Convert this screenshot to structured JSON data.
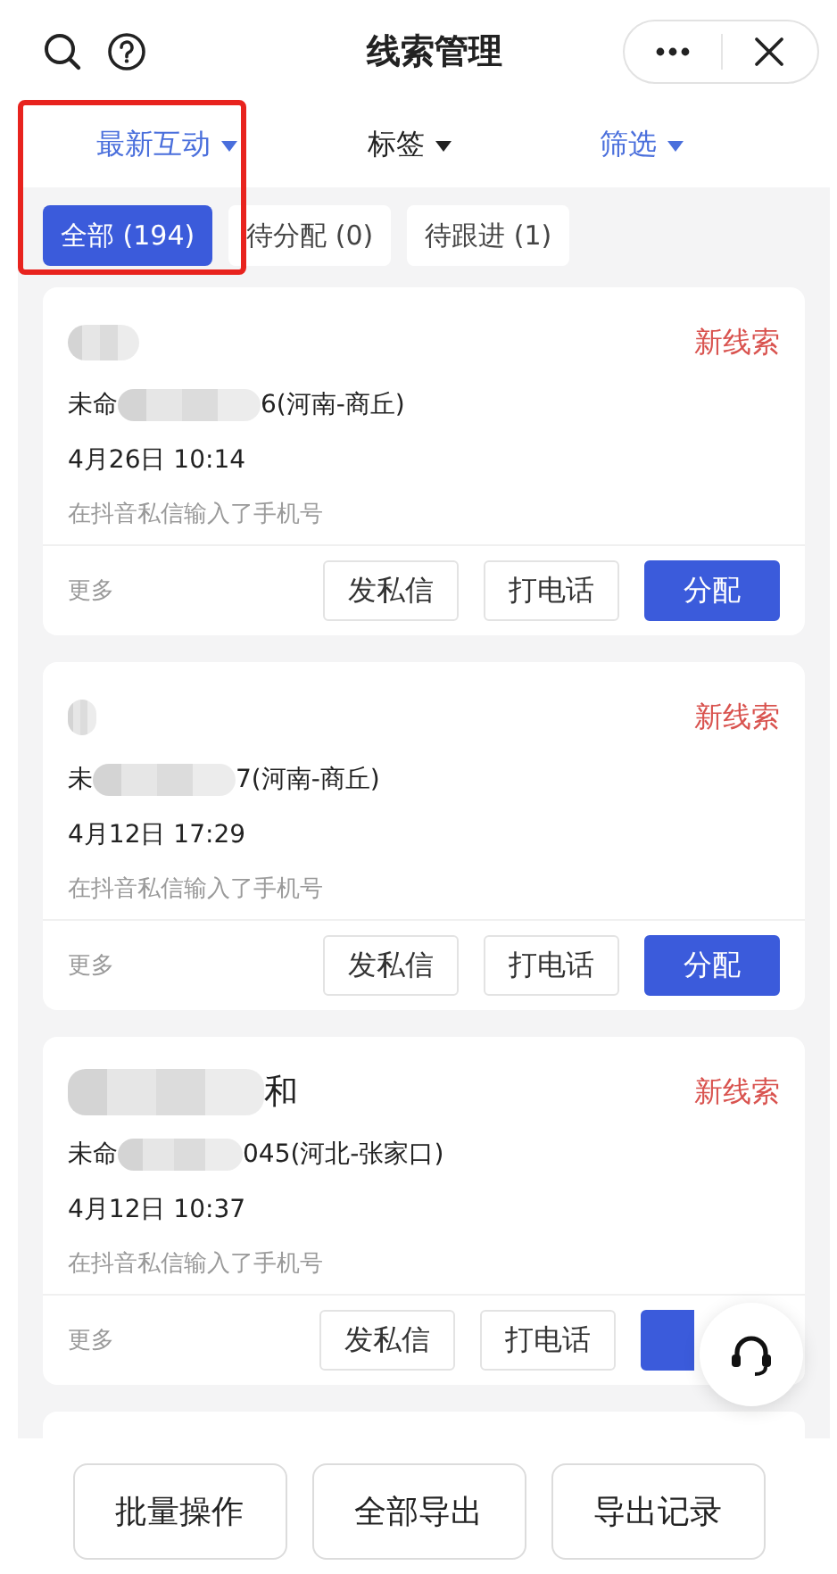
{
  "header": {
    "title": "线索管理"
  },
  "filters": [
    {
      "label": "最新互动",
      "active": true
    },
    {
      "label": "标签",
      "active": false
    },
    {
      "label": "筛选",
      "active": true
    }
  ],
  "highlight_frame": true,
  "chips": [
    {
      "label": "全部 (194)",
      "selected": true
    },
    {
      "label": "待分配 (0)",
      "selected": false
    },
    {
      "label": "待跟进 (1)",
      "selected": false
    }
  ],
  "leads": [
    {
      "phone_prefix": "未命",
      "phone_suffix": "6(河南-商丘)",
      "time": "4月26日 10:14",
      "source": "在抖音私信输入了手机号",
      "status": "新线索",
      "more": "更多",
      "actions": [
        "发私信",
        "打电话",
        "分配"
      ]
    },
    {
      "phone_prefix": "未",
      "phone_suffix": "7(河南-商丘)",
      "time": "4月12日 17:29",
      "source": "在抖音私信输入了手机号",
      "status": "新线索",
      "more": "更多",
      "actions": [
        "发私信",
        "打电话",
        "分配"
      ]
    },
    {
      "name": "和",
      "phone_prefix": "未命",
      "phone_suffix": "045(河北-张家口)",
      "time": "4月12日 10:37",
      "source": "在抖音私信输入了手机号",
      "status": "新线索",
      "more": "更多",
      "actions": [
        "发私信",
        "打电话"
      ],
      "covered_primary": true
    }
  ],
  "bottom_actions": [
    "批量操作",
    "全部导出",
    "导出记录"
  ]
}
